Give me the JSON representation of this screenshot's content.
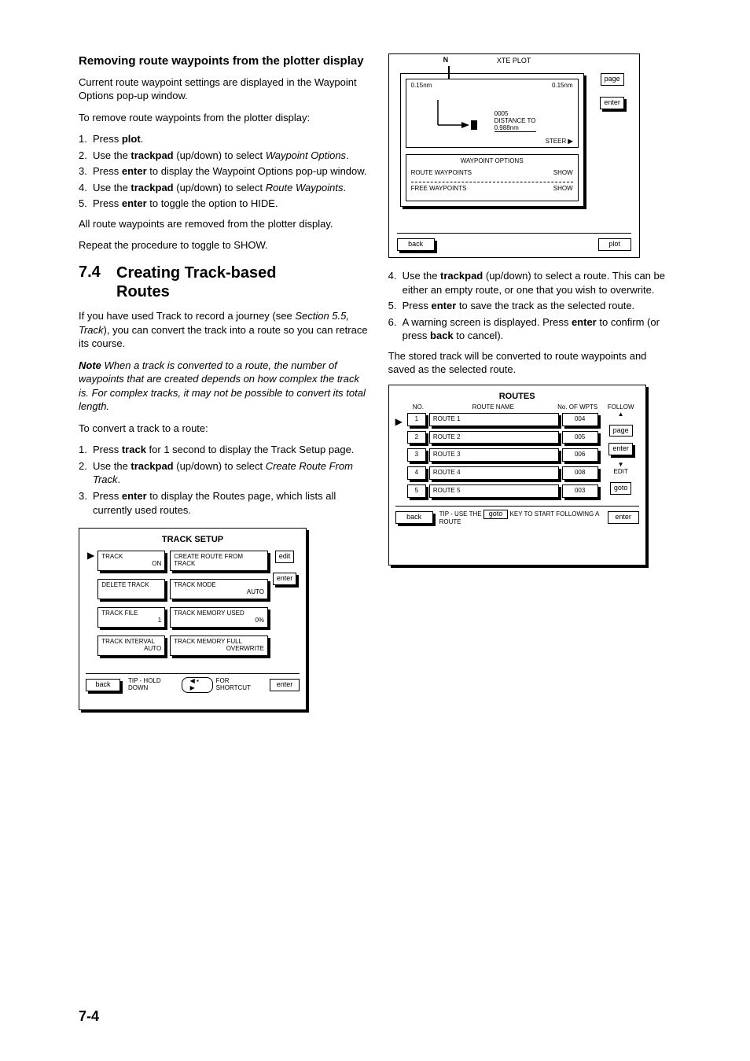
{
  "section1": {
    "heading": "Removing route waypoints from the plotter display",
    "para1": "Current route waypoint settings are displayed in the Waypoint Options pop-up window.",
    "para2": "To remove route waypoints from the plotter display:",
    "steps": [
      "Press plot.",
      "Use the trackpad (up/down) to select Waypoint Options.",
      "Press enter to display the Waypoint Options pop-up window.",
      "Use the trackpad (up/down) to select Route Waypoints.",
      "Press enter to toggle the option to HIDE."
    ],
    "para3": "All route waypoints are removed from the plotter display.",
    "para4": "Repeat the procedure to toggle to SHOW."
  },
  "section2": {
    "num": "7.4",
    "title": "Creating Track-based Routes",
    "para1": "If you have used Track to record a journey (see <i>Section 5.5, Track</i>), you can convert the track into a route so you can retrace its course.",
    "note_label": "Note",
    "note_text": "When a track is converted to a route, the number of waypoints that are created depends on how complex the track is. For complex tracks, it may not be possible to convert its total length.",
    "para2": "To convert a track to a route:",
    "steps": [
      "Press track for 1 second to display the Track Setup page.",
      "Use the trackpad (up/down) to select Create Route From Track.",
      "Press enter to display the Routes page, which lists all currently used routes."
    ],
    "steps_b": [
      "Use the trackpad (up/down) to select a route. This can be either an empty route, or one that you wish to overwrite.",
      "Press enter to save the track as the selected route.",
      "A warning screen is displayed. Press enter to confirm (or press back to cancel)."
    ],
    "para3": "The stored track will be converted to route waypoints and saved as the selected route."
  },
  "panel_plotter": {
    "title": "XTE PLOT",
    "scale_top": "0.15nm",
    "dest": "0005",
    "dist_label": "DISTANCE TO",
    "dist_val": "0.988nm",
    "steer": "STEER",
    "steer_arrow": "▶",
    "waypoint_options": "WAYPOINT OPTIONS",
    "route_wp": "ROUTE WAYPOINTS",
    "free_wp": "FREE WAYPOINTS",
    "show": "SHOW",
    "page_k": "page",
    "enter_k": "enter",
    "back_k": "back",
    "plot_k": "plot"
  },
  "panel_track": {
    "title": "TRACK SETUP",
    "row1_l": "TRACK",
    "row1_r": "CREATE ROUTE FROM TRACK",
    "row2_l": "DELETE TRACK",
    "row2_r": "TRACK MODE AUTO",
    "row3_l": "TRACK FILE 1",
    "row3_r": "TRACK MEMORY USED 0%",
    "row4_l": "TRACK INTERVAL AUTO",
    "row4_r": "TRACK MEMORY FULL OVERWRITE",
    "edit_k": "edit",
    "back_k": "back",
    "enter_k": "enter",
    "tip": "TIP - HOLD DOWN FOR SHORTCUT"
  },
  "panel_routes": {
    "title": "ROUTES",
    "cols": [
      "NO.",
      "ROUTE NAME",
      "No. OF WPTS"
    ],
    "rows": [
      [
        "1",
        "ROUTE 1",
        "004"
      ],
      [
        "2",
        "ROUTE 2",
        "005"
      ],
      [
        "3",
        "ROUTE 3",
        "006"
      ],
      [
        "4",
        "ROUTE 4",
        "008"
      ],
      [
        "5",
        "ROUTE 5",
        "003"
      ]
    ],
    "follow_l": "FOLLOW ▲",
    "edit_l": "EDIT ▼",
    "page_k": "page",
    "enter_k": "enter",
    "goto_k": "goto",
    "back_k": "back",
    "tip": "TIP - USE THE  goto  KEY TO START FOLLOWING A ROUTE"
  },
  "page_num": "7-4"
}
